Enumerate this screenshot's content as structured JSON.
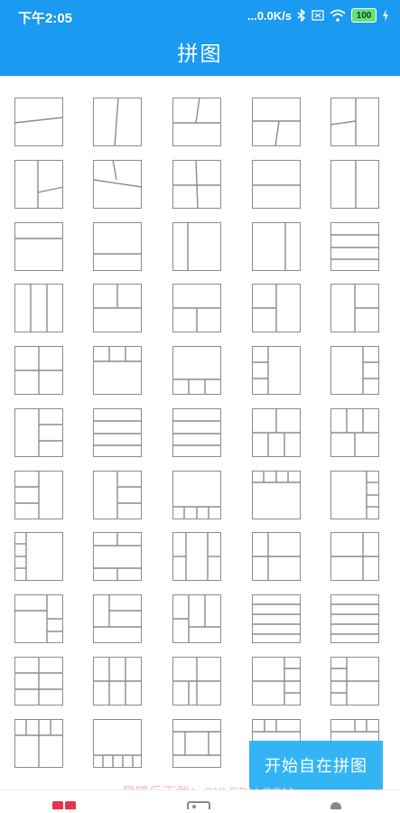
{
  "status_bar": {
    "time": "下午2:05",
    "network_speed": "...0.0K/s",
    "battery": "100",
    "icons": [
      "bluetooth-icon",
      "sim-icon",
      "wifi-icon",
      "battery-icon",
      "charging-icon"
    ]
  },
  "header": {
    "title": "拼图"
  },
  "layouts_grid": {
    "columns": 5,
    "rows_visible": 11
  },
  "fab": {
    "label": "开始自在拼图"
  },
  "watermark": "晨曦乐下载：CXLEDU.COM",
  "bottom_nav": {
    "icons": [
      "puzzle-icon",
      "image-icon",
      "profile-icon"
    ]
  },
  "colors": {
    "primary": "#1a9af0",
    "fab": "#33b5f5",
    "tile_border": "#8c8c8c"
  }
}
